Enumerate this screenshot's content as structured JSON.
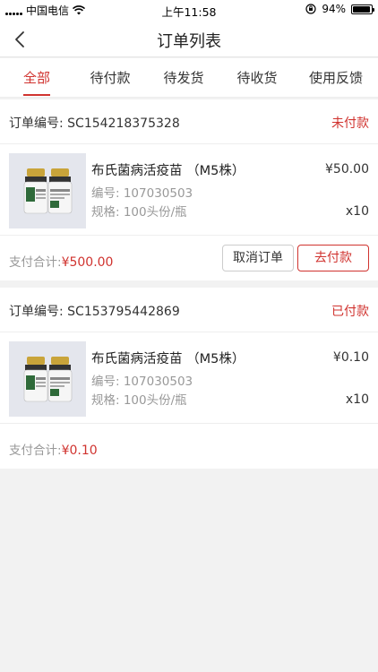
{
  "status_bar": {
    "carrier": "中国电信",
    "time": "上午11:58",
    "battery_text": "94%",
    "battery_level": 0.94
  },
  "nav": {
    "title": "订单列表"
  },
  "tabs": [
    {
      "label": "全部",
      "active": true
    },
    {
      "label": "待付款",
      "active": false
    },
    {
      "label": "待发货",
      "active": false
    },
    {
      "label": "待收货",
      "active": false
    },
    {
      "label": "使用反馈",
      "active": false
    }
  ],
  "orders": [
    {
      "order_label": "订单编号: ",
      "order_no": "SC154218375328",
      "status": "未付款",
      "product_name": "布氏菌病活疫苗 （M5株）",
      "product_code": "编号: 107030503",
      "product_spec": "规格: 100头份/瓶",
      "price": "¥50.00",
      "qty": "x10",
      "total_label": "支付合计:",
      "total_amount": "¥500.00",
      "cancel_label": "取消订单",
      "pay_label": "去付款"
    },
    {
      "order_label": "订单编号: ",
      "order_no": "SC153795442869",
      "status": "已付款",
      "product_name": "布氏菌病活疫苗 （M5株）",
      "product_code": "编号: 107030503",
      "product_spec": "规格: 100头份/瓶",
      "price": "¥0.10",
      "qty": "x10",
      "total_label": "支付合计:",
      "total_amount": "¥0.10"
    }
  ],
  "colors": {
    "accent": "#d0332f",
    "background": "#f2f2f2"
  }
}
